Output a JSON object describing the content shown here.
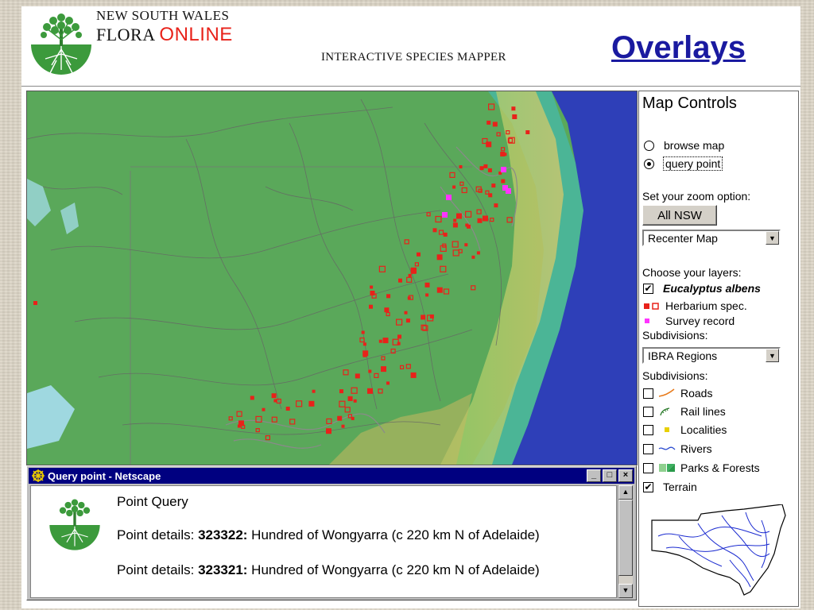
{
  "header": {
    "brand_line1": "NEW SOUTH WALES",
    "brand_line2_a": "FLORA ",
    "brand_line2_b": "ONLINE",
    "subtitle": "INTERACTIVE SPECIES MAPPER",
    "page_title": "Overlays"
  },
  "controls": {
    "title": "Map Controls",
    "modes": [
      {
        "label": "browse map",
        "selected": false
      },
      {
        "label": "query point",
        "selected": true
      }
    ],
    "zoom_label": "Set your zoom option:",
    "zoom_button": "All NSW",
    "zoom_select": "Recenter Map",
    "layers_label": "Choose your layers:",
    "species": {
      "label": "Eucalyptus albens",
      "checked": true
    },
    "legend": [
      {
        "label": "Herbarium spec.",
        "symbol": "red-square-filled-and-outline"
      },
      {
        "label": "Survey record",
        "symbol": "magenta-square"
      }
    ],
    "subdivisions_label": "Subdivisions:",
    "subdivisions_select": "IBRA Regions",
    "subdivisions_label2": "Subdivisions:",
    "overlays": [
      {
        "label": "Roads",
        "checked": false,
        "symbol": "orange-line"
      },
      {
        "label": "Rail lines",
        "checked": false,
        "symbol": "green-rail"
      },
      {
        "label": "Localities",
        "checked": false,
        "symbol": "yellow-dot"
      },
      {
        "label": "Rivers",
        "checked": false,
        "symbol": "blue-wave"
      },
      {
        "label": "Parks & Forests",
        "checked": false,
        "symbol": "green-block"
      },
      {
        "label": "Terrain",
        "checked": true,
        "symbol": "none"
      }
    ],
    "check_mark": "✔"
  },
  "popup": {
    "window_title": "Query point - Netscape",
    "heading": "Point Query",
    "label": "Point details: ",
    "results": [
      {
        "id": "323322:",
        "place": " Hundred of Wongyarra (c 220 km N of Adelaide)"
      },
      {
        "id": "323321:",
        "place": " Hundred of Wongyarra (c 220 km N of Adelaide)"
      }
    ],
    "btn_min": "_",
    "btn_max": "□",
    "btn_close": "×"
  },
  "colors": {
    "title_blue": "#1a1aa0",
    "online_red": "#e8221a",
    "herbarium_red": "#e8221a",
    "survey_magenta": "#ff33ff",
    "ocean": "#2e3fb8",
    "land": "#5aa85a"
  }
}
